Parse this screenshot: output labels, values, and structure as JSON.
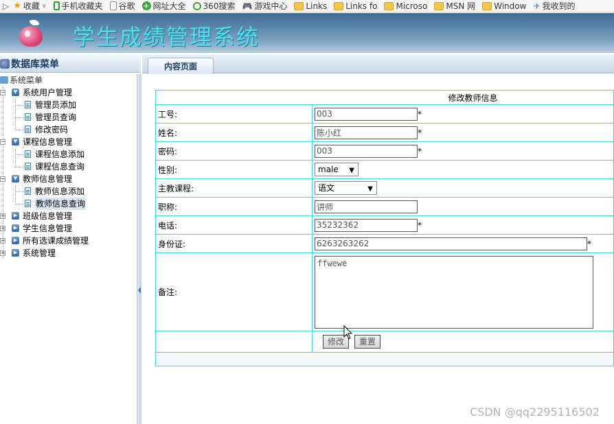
{
  "bookmarks_bar": {
    "items": [
      {
        "icon": "star-icon",
        "label": "收藏",
        "dropdown": true
      },
      {
        "icon": "phone-icon",
        "label": "手机收藏夹"
      },
      {
        "icon": "page-icon",
        "label": "谷歌"
      },
      {
        "icon": "plus-circle-icon",
        "label": "网址大全"
      },
      {
        "icon": "360-icon",
        "label": "360搜索"
      },
      {
        "icon": "gamepad-icon",
        "label": "游戏中心"
      },
      {
        "icon": "folder-icon",
        "label": "Links"
      },
      {
        "icon": "folder-icon",
        "label": "Links fo"
      },
      {
        "icon": "folder-icon",
        "label": "Microso"
      },
      {
        "icon": "folder-icon",
        "label": "MSN 网"
      },
      {
        "icon": "folder-icon",
        "label": "Window"
      },
      {
        "icon": "pin-icon",
        "label": "我收到的"
      }
    ]
  },
  "header": {
    "title": "学生成绩管理系统"
  },
  "sidebar": {
    "title": "数据库菜单",
    "root": "系统菜单",
    "groups": [
      {
        "label": "系统用户管理",
        "expanded": true,
        "items": [
          "管理员添加",
          "管理员查询",
          "修改密码"
        ]
      },
      {
        "label": "课程信息管理",
        "expanded": true,
        "items": [
          "课程信息添加",
          "课程信息查询"
        ]
      },
      {
        "label": "教师信息管理",
        "expanded": true,
        "items": [
          "教师信息添加",
          "教师信息查询"
        ]
      },
      {
        "label": "班级信息管理",
        "expanded": false,
        "items": []
      },
      {
        "label": "学生信息管理",
        "expanded": false,
        "items": []
      },
      {
        "label": "所有选课成绩管理",
        "expanded": false,
        "items": []
      },
      {
        "label": "系统管理",
        "expanded": false,
        "items": []
      }
    ],
    "selected_item": "教师信息查询"
  },
  "content": {
    "tab_label": "内容页面",
    "form": {
      "title": "修改教师信息",
      "required_mark": "*",
      "fields": {
        "id": {
          "label": "工号:",
          "value": "003"
        },
        "name": {
          "label": "姓名:",
          "value": "陈小红"
        },
        "password": {
          "label": "密码:",
          "value": "003"
        },
        "gender": {
          "label": "性别:",
          "value": "male"
        },
        "course": {
          "label": "主教课程:",
          "value": "语文"
        },
        "title": {
          "label": "职称:",
          "value": "讲师"
        },
        "phone": {
          "label": "电话:",
          "value": "35232362"
        },
        "id_card": {
          "label": "身份证:",
          "value": "6263263262"
        },
        "note": {
          "label": "备注:",
          "value": "ffwewe"
        }
      },
      "submit_label": "修改",
      "reset_label": "重置"
    }
  },
  "watermark": "CSDN @qq2295116502",
  "colors": {
    "table_border": "#3fd6e3",
    "header_title": "#4ee0ee",
    "sidebar_title": "#1b3c66"
  }
}
